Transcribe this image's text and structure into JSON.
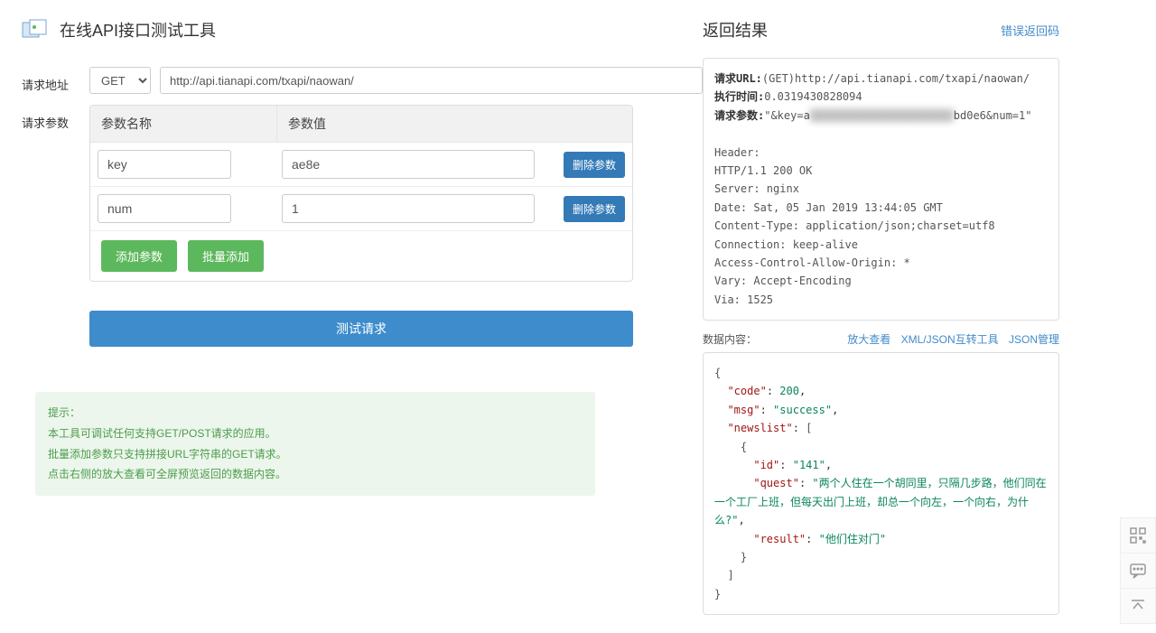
{
  "page": {
    "title": "在线API接口测试工具"
  },
  "request": {
    "addr_label": "请求地址",
    "method": "GET",
    "url": "http://api.tianapi.com/txapi/naowan/",
    "params_label": "请求参数",
    "col_name": "参数名称",
    "col_value": "参数值",
    "items": [
      {
        "key": "key",
        "value": "ae8e",
        "value_hidden": "████████████████████",
        "value_tail": ";"
      },
      {
        "key": "num",
        "value": "1"
      }
    ],
    "del_btn": "删除参数",
    "add_btn": "添加参数",
    "batch_btn": "批量添加",
    "submit_btn": "测试请求"
  },
  "tips": {
    "head": "提示：",
    "lines": [
      "本工具可调试任何支持GET/POST请求的应用。",
      "批量添加参数只支持拼接URL字符串的GET请求。",
      "点击右侧的放大查看可全屏预览返回的数据内容。"
    ]
  },
  "result": {
    "title": "返回结果",
    "err_link": "错误返回码",
    "req_url_label": "请求URL:",
    "req_url": "(GET)http://api.tianapi.com/txapi/naowan/",
    "time_label": "执行时间:",
    "time": "0.0319430828094",
    "params_label": "请求参数:",
    "params_prefix": "\"&key=a",
    "params_mask": "██████████████████████",
    "params_suffix": "bd0e6&num=1\"",
    "header_lines": [
      "Header:",
      "HTTP/1.1 200 OK",
      "Server: nginx",
      "Date: Sat, 05 Jan 2019 13:44:05 GMT",
      "Content-Type: application/json;charset=utf8",
      "Connection: keep-alive",
      "Access-Control-Allow-Origin: *",
      "Vary: Accept-Encoding",
      "Via: 1525"
    ]
  },
  "data": {
    "label": "数据内容：",
    "links": {
      "enlarge": "放大查看",
      "xmljson": "XML/JSON互转工具",
      "jsonmgr": "JSON管理"
    },
    "json": {
      "code": 200,
      "msg": "success",
      "newslist": [
        {
          "id": "141",
          "quest": "两个人住在一个胡同里，只隔几步路，他们同在一个工厂上班，但每天出门上班，却总一个向左，一个向右，为什么?",
          "result": "他们住对门"
        }
      ]
    }
  },
  "side": {
    "qr": "qr",
    "chat": "chat",
    "top": "top"
  }
}
